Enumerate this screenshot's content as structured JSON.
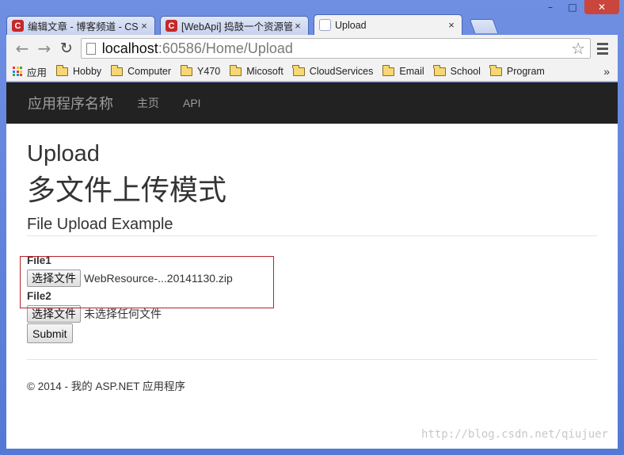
{
  "window": {
    "controls": [
      "–",
      "□",
      "✕"
    ]
  },
  "tabs": [
    {
      "title": "编辑文章 - 博客频道 - CSDN",
      "favicon": "C",
      "close": "×"
    },
    {
      "title": "[WebApi] 捣鼓一个资源管理",
      "favicon": "C",
      "close": "×"
    },
    {
      "title": "Upload",
      "favicon": "",
      "close": "×"
    }
  ],
  "toolbar": {
    "back": "←",
    "forward": "→",
    "reload": "↻",
    "url_host": "localhost",
    "url_rest": ":60586/Home/Upload",
    "star": "☆"
  },
  "bookmarks": {
    "apps_label": "应用",
    "items": [
      "Hobby",
      "Computer",
      "Y470",
      "Micosoft",
      "CloudServices",
      "Email",
      "School",
      "Program"
    ],
    "more": "»",
    "apps_colors": [
      "#e53935",
      "#fbc02d",
      "#43a047",
      "#1e88e5",
      "#e53935",
      "#fbc02d",
      "#43a047",
      "#1e88e5",
      "#e53935"
    ]
  },
  "page": {
    "navbar": {
      "brand": "应用程序名称",
      "links": [
        "主页",
        "API"
      ]
    },
    "title": "Upload",
    "subtitle": "多文件上传模式",
    "legend": "File Upload Example",
    "file1": {
      "label": "File1",
      "button": "选择文件",
      "filename": "WebResource-...20141130.zip"
    },
    "file2": {
      "label": "File2",
      "button": "选择文件",
      "filename": "未选择任何文件"
    },
    "submit": "Submit",
    "footer": "© 2014 - 我的 ASP.NET 应用程序"
  },
  "watermark": "http://blog.csdn.net/qiujuer",
  "colors": {
    "navbar_bg": "#222222",
    "highlight_border": "#b8232a",
    "window_frame": "#5a7ed8"
  }
}
